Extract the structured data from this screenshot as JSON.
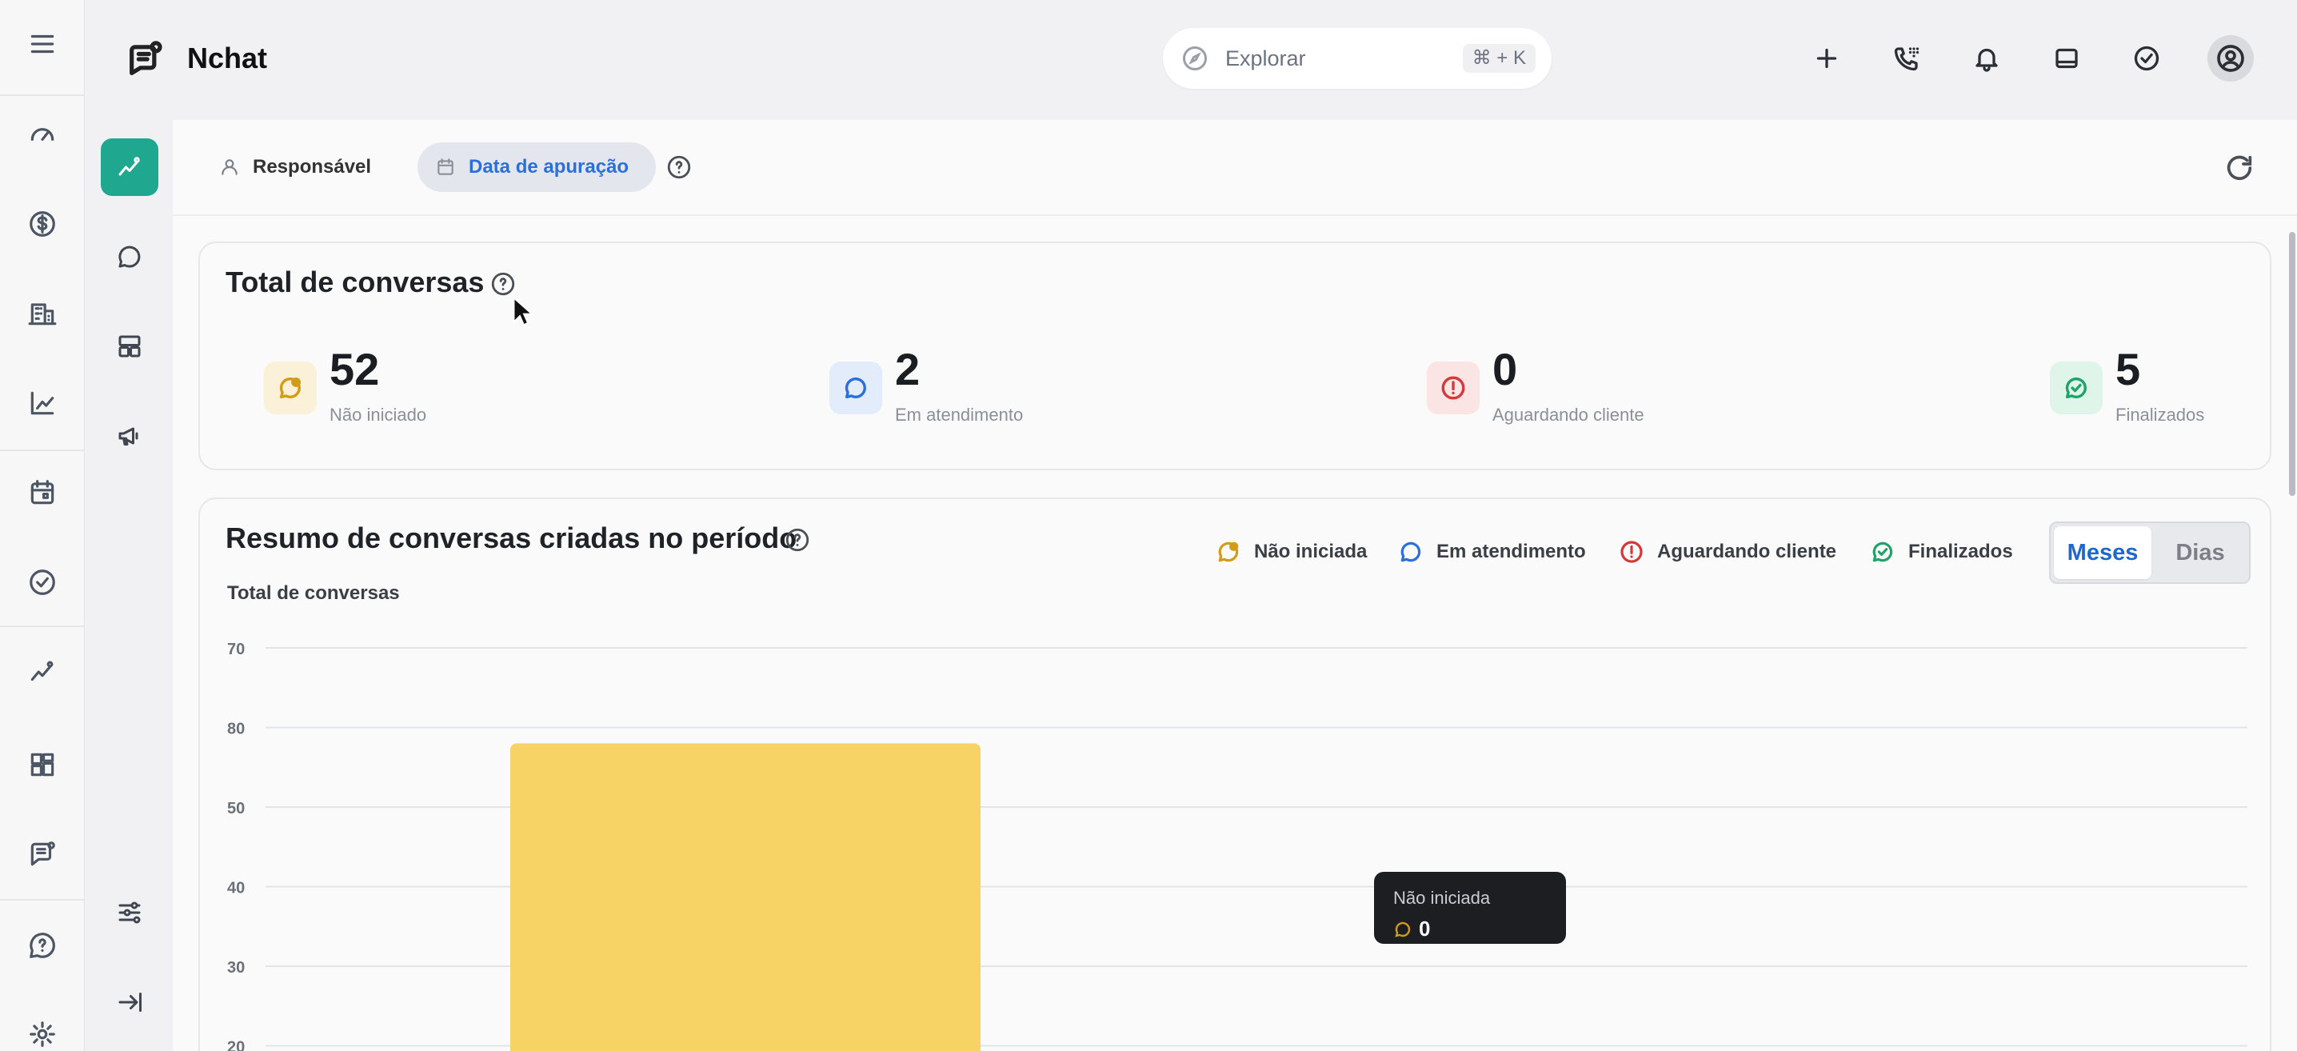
{
  "app": {
    "name": "Nchat"
  },
  "search": {
    "placeholder": "Explorar",
    "shortcut": "⌘ + K"
  },
  "filters": {
    "responsible": "Responsável",
    "date": "Data de apuração"
  },
  "summary": {
    "title": "Total de conversas",
    "stats": [
      {
        "value": "52",
        "label": "Não iniciado",
        "icon": "chat-dot-icon",
        "color": "#d29b18",
        "bg": "#fbf1d8"
      },
      {
        "value": "2",
        "label": "Em atendimento",
        "icon": "chat-bubble-icon",
        "color": "#2a6fdb",
        "bg": "#e3ecfb"
      },
      {
        "value": "0",
        "label": "Aguardando cliente",
        "icon": "alert-circle-icon",
        "color": "#d23a3a",
        "bg": "#fbe4e4"
      },
      {
        "value": "5",
        "label": "Finalizados",
        "icon": "chat-check-icon",
        "color": "#1fa36b",
        "bg": "#dff5ea"
      }
    ]
  },
  "period": {
    "title": "Resumo de conversas criadas no período",
    "legend": [
      "Não iniciada",
      "Em atendimento",
      "Aguardando cliente",
      "Finalizados"
    ],
    "toggle": {
      "months": "Meses",
      "days": "Dias"
    }
  },
  "chart_data": {
    "type": "bar",
    "ylabel": "Total de conversas",
    "yticks": [
      70,
      60,
      50,
      40,
      30,
      20
    ],
    "ytick_labels": [
      "70",
      "80",
      "50",
      "40",
      "30",
      "20"
    ],
    "ylim": [
      20,
      70
    ],
    "series": [
      {
        "name": "Não iniciada",
        "color": "#f7d264",
        "values": [
          58
        ]
      }
    ],
    "tooltip": {
      "title": "Não iniciada",
      "value": "0"
    }
  }
}
